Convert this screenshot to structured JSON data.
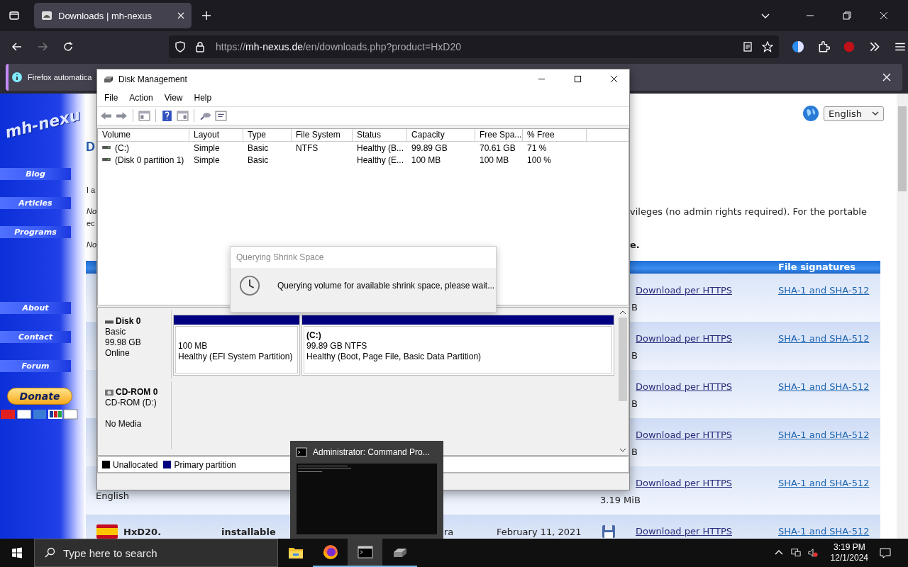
{
  "browser": {
    "tabs": [
      {
        "title": "Downloads | mh-nexus",
        "selected": true
      }
    ],
    "url": {
      "scheme": "https://",
      "host": "mh-nexus.de",
      "path": "/en/downloads.php?product=HxD20"
    },
    "notification": {
      "text": "Firefox automatica"
    }
  },
  "page": {
    "logo": "mh-nexu",
    "nav_groups": [
      {
        "items": [
          {
            "label": "Blog"
          },
          {
            "label": "Articles"
          },
          {
            "label": "Programs"
          }
        ]
      },
      {
        "items": [
          {
            "label": "About"
          },
          {
            "label": "Contact"
          },
          {
            "label": "Forum"
          }
        ]
      }
    ],
    "donate": "Donate",
    "language": "English",
    "heading": "D",
    "lines": [
      {
        "left": "I a"
      },
      {
        "left": "No",
        "left_italic": true,
        "right": "vileges (no admin rights required). For the portable"
      },
      {
        "left": "ec"
      },
      {
        "left": "No",
        "left_italic": true,
        "right": "e.",
        "right_bold": true
      }
    ],
    "table_header": "File signatures",
    "rows": [
      {
        "size": "B",
        "link": "Download per HTTPS",
        "signature": "SHA-1 and SHA-512"
      },
      {
        "size": "B",
        "link": "Download per HTTPS",
        "signature": "SHA-1 and SHA-512"
      },
      {
        "size": "B",
        "link": "Download per HTTPS",
        "signature": "SHA-1 and SHA-512"
      },
      {
        "size": "B",
        "link": "Download per HTTPS",
        "signature": "SHA-1 and SHA-512"
      },
      {
        "label": "English",
        "size": "3.19 MiB",
        "link": "Download per HTTPS",
        "signature": "SHA-1 and SHA-512"
      },
      {
        "name": "HxD20.",
        "edition": "installable",
        "column_3": "ra",
        "date": "February 11, 2021",
        "floppy": true,
        "link": "Download per HTTPS",
        "signature": "SHA-1 and SHA-512"
      }
    ]
  },
  "disk_management": {
    "title": "Disk Management",
    "menu": [
      "File",
      "Action",
      "View",
      "Help"
    ],
    "columns": [
      "Volume",
      "Layout",
      "Type",
      "File System",
      "Status",
      "Capacity",
      "Free Spa...",
      "% Free"
    ],
    "volumes": [
      {
        "volume": "(C:)",
        "layout": "Simple",
        "type": "Basic",
        "file_system": "NTFS",
        "status": "Healthy (B...",
        "capacity": "99.89 GB",
        "free_space": "70.61 GB",
        "percent_free": "71 %"
      },
      {
        "volume": "(Disk 0 partition 1)",
        "layout": "Simple",
        "type": "Basic",
        "status": "Healthy (E...",
        "capacity": "100 MB",
        "free_space": "100 MB",
        "percent_free": "100 %"
      }
    ],
    "disks": [
      {
        "kind": "disk",
        "name": "Disk 0",
        "lines": [
          "Basic",
          "99.98 GB",
          "Online"
        ],
        "partitions": [
          {
            "kind": "primary",
            "size": "100 MB",
            "status": "Healthy (EFI System Partition)"
          },
          {
            "kind": "primary",
            "name": "(C:)",
            "size": "99.89 GB NTFS",
            "status": "Healthy (Boot, Page File, Basic Data Partition)"
          }
        ]
      },
      {
        "kind": "cdrom",
        "name": "CD-ROM 0",
        "lines": [
          "CD-ROM (D:)",
          "No Media"
        ]
      }
    ],
    "legend": [
      {
        "label": "Unallocated",
        "color": "#000000"
      },
      {
        "label": "Primary partition",
        "color": "#000080"
      }
    ]
  },
  "dialog": {
    "title": "Querying Shrink Space",
    "message": "Querying volume for available shrink space, please wait..."
  },
  "cmd_preview": {
    "title": "Administrator: Command Pro..."
  },
  "taskbar": {
    "search_placeholder": "Type here to search",
    "apps": [
      {
        "kind": "explorer",
        "open": false,
        "selected": false
      },
      {
        "kind": "firefox",
        "open": true,
        "selected": false
      },
      {
        "kind": "terminal",
        "open": true,
        "selected": true
      },
      {
        "kind": "disk",
        "open": true,
        "selected": false
      }
    ],
    "time": "3:19 PM",
    "date": "12/1/2024"
  }
}
